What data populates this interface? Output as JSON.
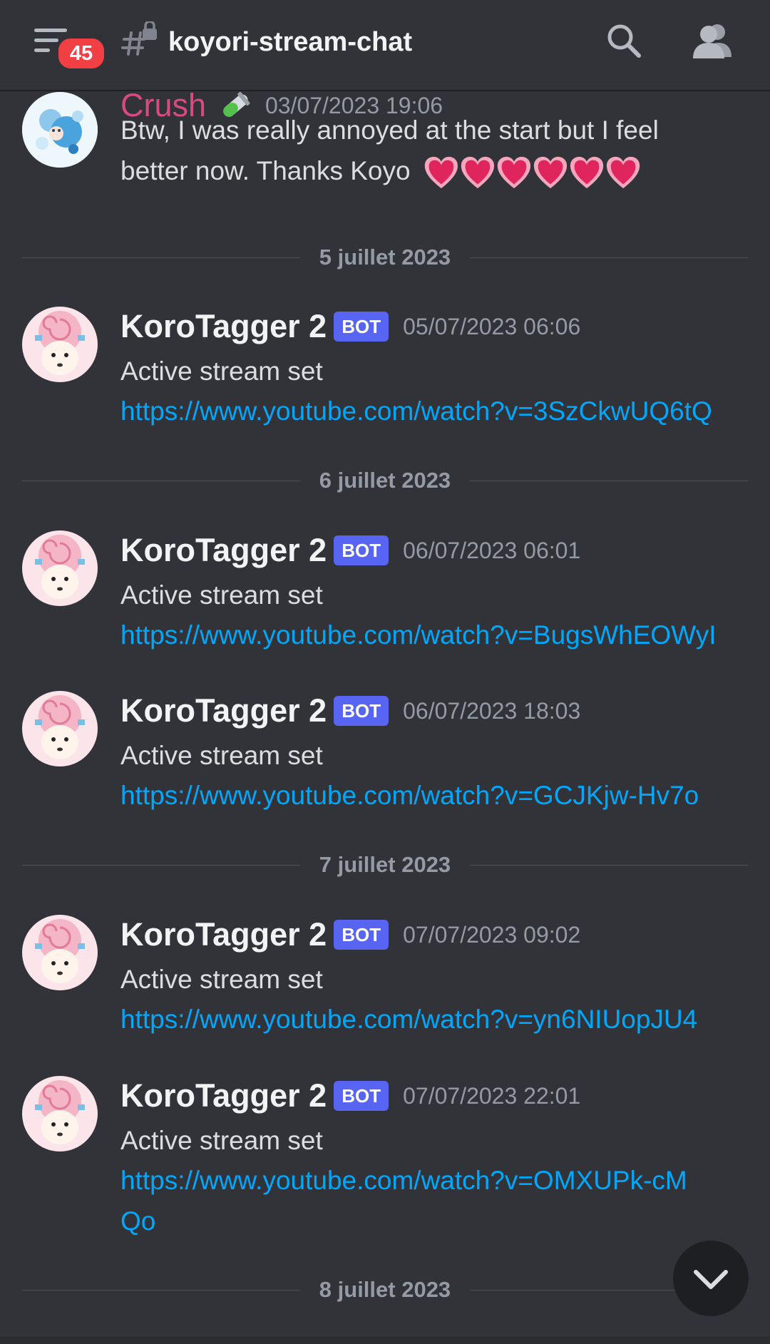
{
  "header": {
    "unread_badge": "45",
    "channel_name": "koyori-stream-chat"
  },
  "messages": [
    {
      "author": "Crush",
      "timestamp": "03/07/2023 19:06",
      "text_line1": "Btw, I was really annoyed at the start but I feel",
      "text_line2": "better now. Thanks Koyo",
      "emoji": "heart-emoji x6"
    },
    {
      "author": "KoroTagger 2",
      "bot_label": "BOT",
      "timestamp": "05/07/2023 06:06",
      "text": "Active stream set",
      "link": "https://www.youtube.com/watch?v=3SzCkwUQ6tQ"
    },
    {
      "author": "KoroTagger 2",
      "bot_label": "BOT",
      "timestamp": "06/07/2023 06:01",
      "text": "Active stream set",
      "link": "https://www.youtube.com/watch?v=BugsWhEOWyI"
    },
    {
      "author": "KoroTagger 2",
      "bot_label": "BOT",
      "timestamp": "06/07/2023 18:03",
      "text": "Active stream set",
      "link": "https://www.youtube.com/watch?v=GCJKjw-Hv7o"
    },
    {
      "author": "KoroTagger 2",
      "bot_label": "BOT",
      "timestamp": "07/07/2023 09:02",
      "text": "Active stream set",
      "link": "https://www.youtube.com/watch?v=yn6NIUopJU4"
    },
    {
      "author": "KoroTagger 2",
      "bot_label": "BOT",
      "timestamp": "07/07/2023 22:01",
      "text": "Active stream set",
      "link": "https://www.youtube.com/watch?v=OMXUPk-cMQo"
    }
  ],
  "dividers": [
    "5 juillet 2023",
    "6 juillet 2023",
    "7 juillet 2023",
    "8 juillet 2023"
  ],
  "colors": {
    "background": "#313338",
    "link": "#00a8fc",
    "bot_tag": "#5865f2",
    "badge": "#f23f43",
    "crush_name": "#d94a82"
  },
  "icons": [
    "menu-icon",
    "hash-lock-icon",
    "search-icon",
    "members-icon",
    "chevron-down-icon",
    "test-tube-icon"
  ]
}
